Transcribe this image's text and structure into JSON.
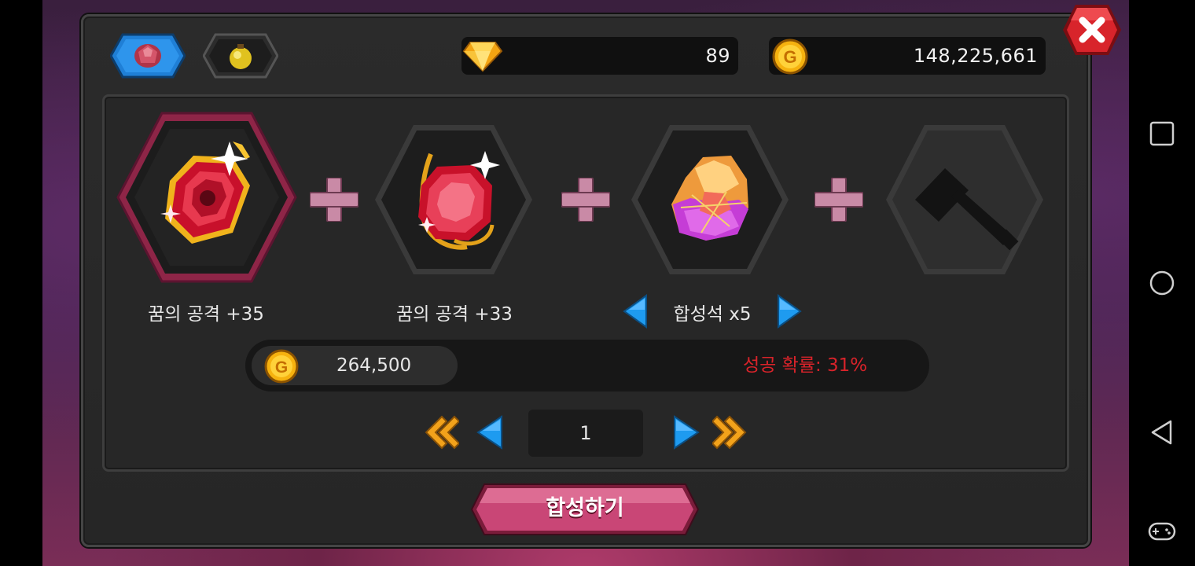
{
  "tabs": [
    {
      "name": "ruby-tab",
      "icon": "red-gem-icon",
      "active": true
    },
    {
      "name": "potion-tab",
      "icon": "yellow-potion-icon",
      "active": false
    }
  ],
  "currencies": {
    "diamonds": {
      "icon": "diamond-icon",
      "value": "89"
    },
    "gold": {
      "icon": "gold-coin-icon",
      "value": "148,225,661"
    }
  },
  "slots": [
    {
      "icon": "ornate-ruby-gem-icon",
      "label": "꿈의 공격 +35",
      "selected": true
    },
    {
      "icon": "ruby-gem-icon",
      "label": "꿈의 공격 +33",
      "selected": false
    },
    {
      "icon": "synthesis-stone-icon",
      "label": "합성석 x5",
      "selected": false
    },
    {
      "icon": "hammer-icon",
      "label": "",
      "selected": false
    }
  ],
  "cost": {
    "icon": "gold-coin-icon",
    "value": "264,500"
  },
  "success_rate": "성공 확률: 31%",
  "pager": {
    "page": "1"
  },
  "combine_button": "합성하기",
  "colors": {
    "accent_pink": "#b83a68",
    "success_red": "#d8232a",
    "arrow_blue": "#1e9bf0",
    "arrow_gold": "#f2a21b"
  }
}
